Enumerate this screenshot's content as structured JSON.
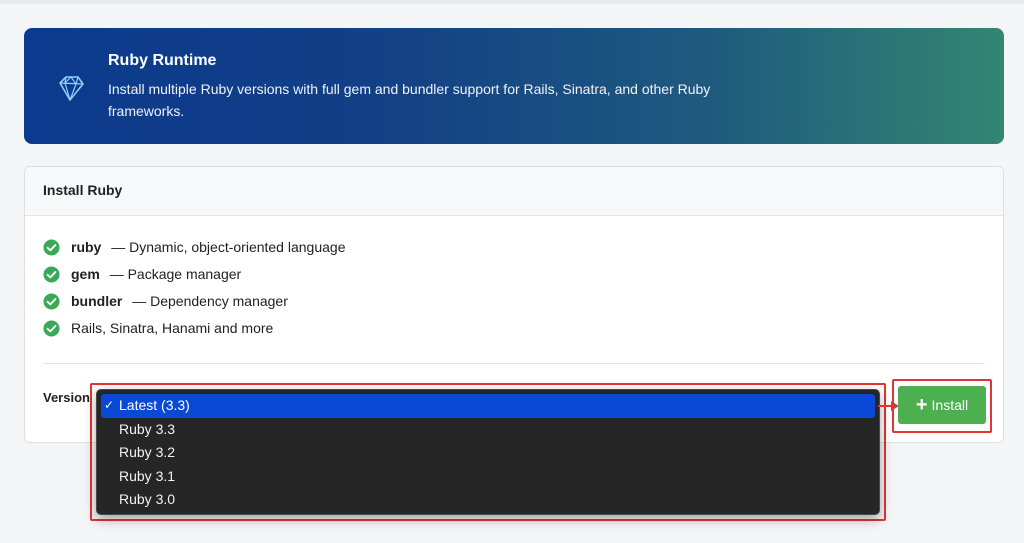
{
  "banner": {
    "title": "Ruby Runtime",
    "description": "Install multiple Ruby versions with full gem and bundler support for Rails, Sinatra, and other Ruby frameworks.",
    "icon": "ruby-gem-icon"
  },
  "card": {
    "title": "Install Ruby",
    "features": [
      {
        "name": "ruby",
        "desc": "— Dynamic, object-oriented language"
      },
      {
        "name": "gem",
        "desc": "— Package manager"
      },
      {
        "name": "bundler",
        "desc": "— Dependency manager"
      },
      {
        "name": "",
        "desc": "Rails, Sinatra, Hanami and more"
      }
    ],
    "version_label": "Version",
    "version_options": [
      "Latest (3.3)",
      "Ruby 3.3",
      "Ruby 3.2",
      "Ruby 3.1",
      "Ruby 3.0"
    ],
    "selected_tick": "✓",
    "install_label": "Install",
    "install_plus": "+"
  },
  "colors": {
    "banner_start": "#0c3a8e",
    "banner_end": "#338672",
    "check_green": "#3aa856",
    "install_green": "#4caf50",
    "select_blue": "#0a48d6",
    "highlight_red": "#e23434"
  }
}
